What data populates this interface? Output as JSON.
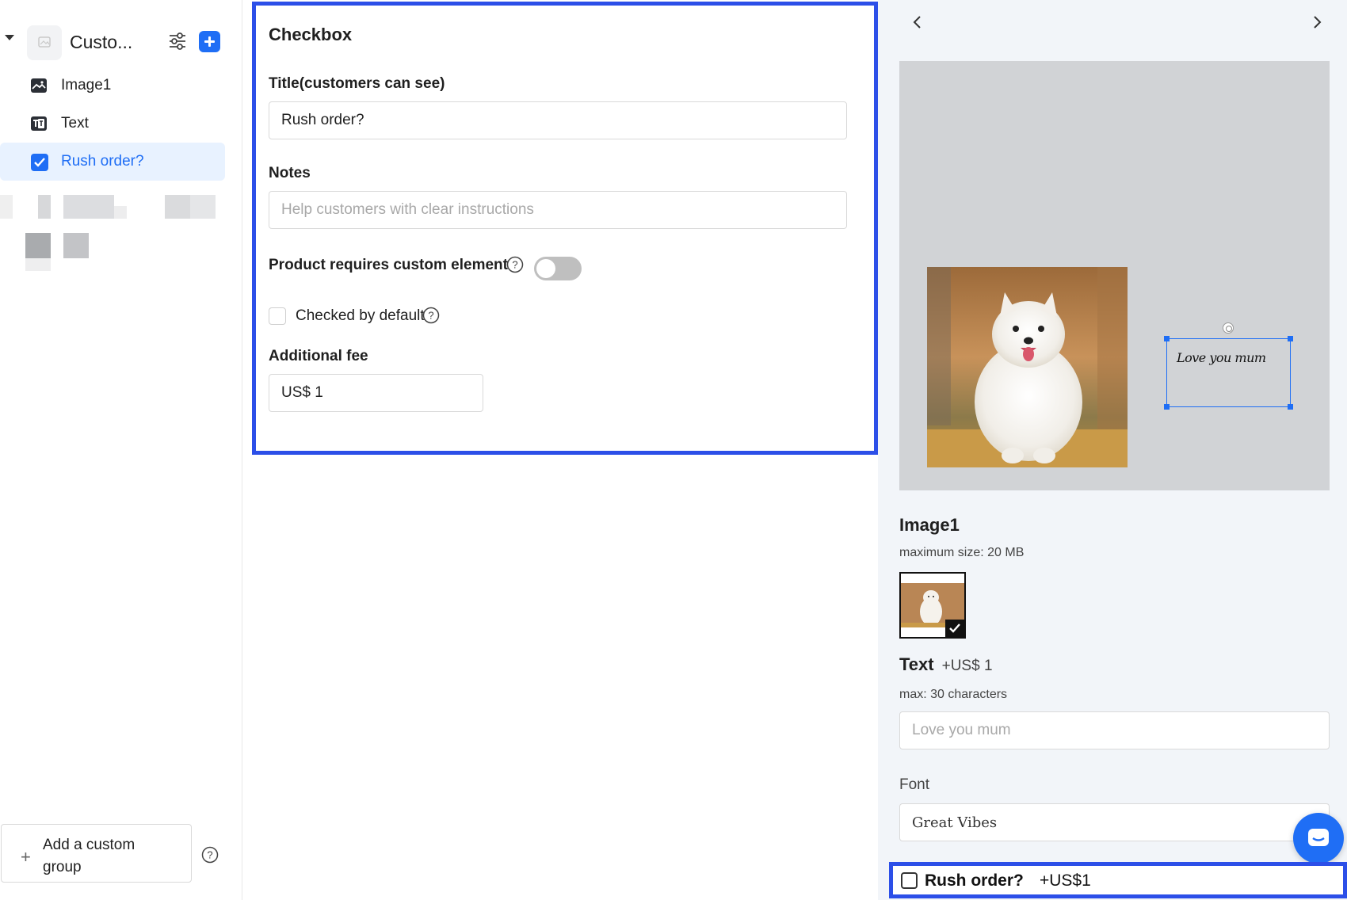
{
  "sidebar": {
    "group_title": "Custo...",
    "items": [
      {
        "label": "Image1",
        "icon": "image-icon"
      },
      {
        "label": "Text",
        "icon": "text-icon"
      },
      {
        "label": "Rush order?",
        "icon": "checkbox-icon",
        "active": true
      }
    ],
    "add_group_label": "Add a custom group"
  },
  "config": {
    "title": "Checkbox",
    "title_label": "Title(customers can see)",
    "title_value": "Rush order?",
    "notes_label": "Notes",
    "notes_placeholder": "Help customers with clear instructions",
    "requires_label": "Product requires custom element",
    "requires_enabled": false,
    "checked_default_label": "Checked by default",
    "checked_default": false,
    "fee_label": "Additional fee",
    "fee_value": "US$ 1"
  },
  "preview": {
    "canvas_text": "Love you mum",
    "image_heading": "Image1",
    "image_max_size": "maximum size: 20 MB",
    "text_heading": "Text",
    "text_fee": "+US$ 1",
    "text_max": "max: 30 characters",
    "text_placeholder": "Love you mum",
    "font_label": "Font",
    "font_value": "Great Vibes",
    "rush_label": "Rush order?",
    "rush_fee": "+US$1"
  },
  "colors": {
    "accent": "#1f6ef5",
    "highlight_border": "#2c4fe8",
    "canvas_bg": "#d1d3d6",
    "panel_bg": "#f2f5f9"
  }
}
